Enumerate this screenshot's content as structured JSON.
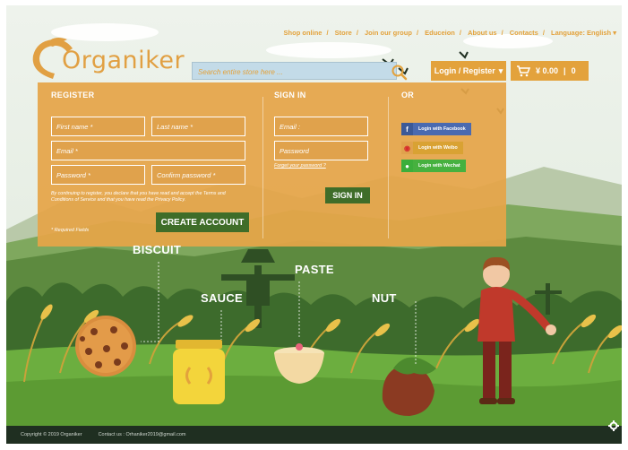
{
  "nav": {
    "items": [
      "Shop online",
      "Store",
      "Join our group",
      "Educeion",
      "About us",
      "Contacts"
    ],
    "language": "Language: English"
  },
  "brand": {
    "name": "Organiker"
  },
  "search": {
    "placeholder": "Search entire store here ..."
  },
  "account": {
    "login_label": "Login / Register"
  },
  "cart": {
    "total": "¥ 0.00",
    "count": "0"
  },
  "register": {
    "heading": "REGISTER",
    "first_name": "First name *",
    "last_name": "Last name *",
    "email": "Email *",
    "password": "Password *",
    "confirm_password": "Confirm password *",
    "terms": "By continuing to register, you declare that you have read and accept the Terms and Conditions of Service and that you have read the Privacy Policy.",
    "submit": "CREATE ACCOUNT",
    "required_note": "* Required Fields"
  },
  "signin": {
    "heading": "SIGN IN",
    "email": "Email :",
    "password": "Password",
    "forgot": "Forget your password ?",
    "submit": "SIGN IN"
  },
  "social": {
    "heading": "OR",
    "facebook": "Login with Facebook",
    "weibo": "Login with Weibo",
    "wechat": "Login with Wechat"
  },
  "scene_labels": {
    "biscuit": "BISCUIT",
    "paste": "PASTE",
    "sauce": "SAUCE",
    "nut": "NUT"
  },
  "footer": {
    "copyright": "Copyright © 2019 Organiker",
    "contact": "Contact us : Orhaniker2019@gmail.com"
  },
  "colors": {
    "accent": "#e3a23c",
    "panel": "#e5a548",
    "button_green": "#3f6d29",
    "footer": "#1f2f21"
  },
  "icons": [
    "search-icon",
    "cart-icon",
    "facebook-icon",
    "weibo-icon",
    "wechat-icon",
    "gear-icon",
    "caret-down-icon"
  ]
}
